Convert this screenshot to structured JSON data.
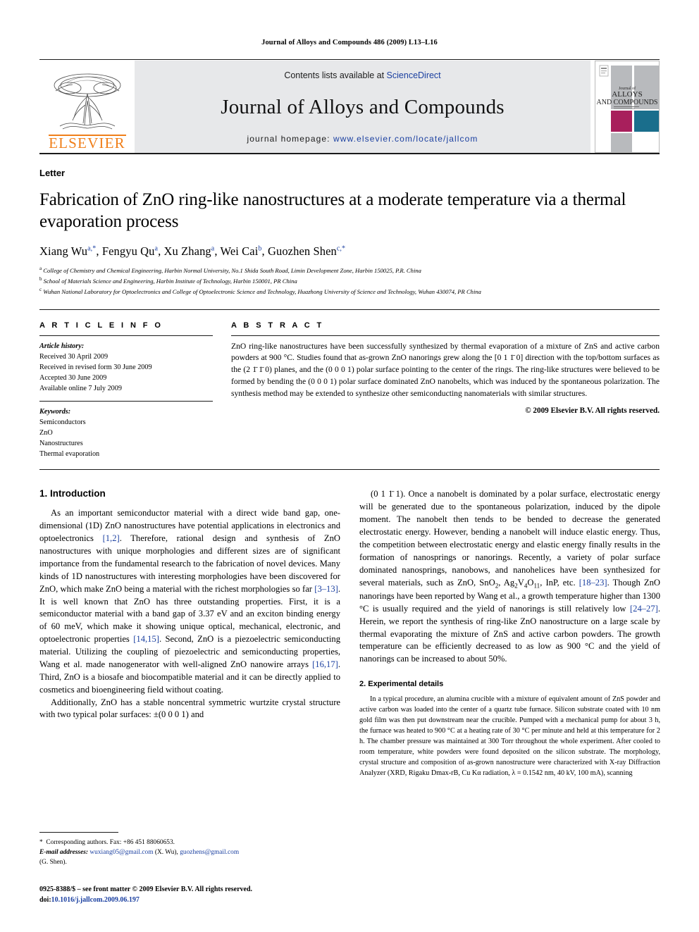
{
  "running_head": "Journal of Alloys and Compounds 486 (2009) L13–L16",
  "masthead": {
    "contents_prefix": "Contents lists available at ",
    "sciencedirect": "ScienceDirect",
    "journal_title": "Journal of Alloys and Compounds",
    "homepage_prefix": "journal homepage: ",
    "homepage_url": "www.elsevier.com/locate/jallcom",
    "publisher_wordmark": "ELSEVIER",
    "cover": {
      "line1": "Journal of",
      "line2": "ALLOYS",
      "line3": "AND COMPOUNDS",
      "accent_magenta": "#a81f5c",
      "accent_teal": "#1a6e8c",
      "panel_gray": "#b8babd"
    },
    "link_color": "#1a3fa0",
    "elsevier_orange": "#f07f1a",
    "band_gray": "#e7e8ea"
  },
  "article": {
    "doctype": "Letter",
    "title": "Fabrication of ZnO ring-like nanostructures at a moderate temperature via a thermal evaporation process",
    "authors": [
      {
        "name": "Xiang Wu",
        "marks": "a,*"
      },
      {
        "name": "Fengyu Qu",
        "marks": "a"
      },
      {
        "name": "Xu Zhang",
        "marks": "a"
      },
      {
        "name": "Wei Cai",
        "marks": "b"
      },
      {
        "name": "Guozhen Shen",
        "marks": "c,*"
      }
    ],
    "affiliations": [
      {
        "mark": "a",
        "text": "College of Chemistry and Chemical Engineering, Harbin Normal University, No.1 Shida South Road, Limin Development Zone, Harbin 150025, P.R. China"
      },
      {
        "mark": "b",
        "text": "School of Materials Science and Engineering, Harbin Institute of Technology, Harbin 150001, PR China"
      },
      {
        "mark": "c",
        "text": "Wuhan National Laboratory for Optoelectronics and College of Optoelectronic Science and Technology, Huazhong University of Science and Technology, Wuhan 430074, PR China"
      }
    ]
  },
  "info": {
    "heading": "A R T I C L E    I N F O",
    "history_label": "Article history:",
    "history": [
      "Received 30 April 2009",
      "Received in revised form 30 June 2009",
      "Accepted 30 June 2009",
      "Available online 7 July 2009"
    ],
    "keywords_label": "Keywords:",
    "keywords": [
      "Semiconductors",
      "ZnO",
      "Nanostructures",
      "Thermal evaporation"
    ]
  },
  "abstract": {
    "heading": "A B S T R A C T",
    "p1": "ZnO ring-like nanostructures have been successfully synthesized by thermal evaporation of a mixture of ZnS and active carbon powders at 900 °C. Studies found that as-grown ZnO nanorings grew along the [0 1 1̄ 0] direction with the top/bottom surfaces as the (2 1̄ 1̄ 0) planes, and the (0 0 0 1) polar surface pointing to the center of the rings. The ring-like structures were believed to be formed by bending the (0 0 0 1) polar surface dominated ZnO nanobelts, which was induced by the spontaneous polarization. The synthesis method may be extended to synthesize other semiconducting nanomaterials with similar structures.",
    "copyright": "© 2009 Elsevier B.V. All rights reserved."
  },
  "sections": {
    "intro_heading": "1.  Introduction",
    "experimental_heading": "2.  Experimental details"
  },
  "body": {
    "intro_p1_a": "As an important semiconductor material with a direct wide band gap, one-dimensional (1D) ZnO nanostructures have potential applications in electronics and optoelectronics ",
    "cite_1_2": "[1,2]",
    "intro_p1_b": ". Therefore, rational design and synthesis of ZnO nanostructures with unique morphologies and different sizes are of significant importance from the fundamental research to the fabrication of novel devices. Many kinds of 1D nanostructures with interesting morphologies have been discovered for ZnO, which make ZnO being a material with the richest morphologies so far ",
    "cite_3_13": "[3–13]",
    "intro_p1_c": ". It is well known that ZnO has three outstanding properties. First, it is a semiconductor material with a band gap of 3.37 eV and an exciton binding energy of 60 meV, which make it showing unique optical, mechanical, electronic, and optoelectronic properties ",
    "cite_14_15": "[14,15]",
    "intro_p1_d": ". Second, ZnO is a piezoelectric semiconducting material. Utilizing the coupling of piezoelectric and semiconducting properties, Wang et al. made nanogenerator with well-aligned ZnO nanowire arrays ",
    "cite_16_17": "[16,17]",
    "intro_p1_e": ". Third, ZnO is a biosafe and biocompatible material and it can be directly applied to cosmetics and bioengineering field without coating.",
    "intro_p2": "Additionally, ZnO has a stable noncentral symmetric wurtzite crystal structure with two typical polar surfaces: ±(0 0 0 1) and",
    "right_p1_a": "(0 1 1̄ 1). Once a nanobelt is dominated by a polar surface, electrostatic energy will be generated due to the spontaneous polarization, induced by the dipole moment. The nanobelt then tends to be bended to decrease the generated electrostatic energy. However, bending a nanobelt will induce elastic energy. Thus, the competition between electrostatic energy and elastic energy finally results in the formation of nanosprings or nanorings. Recently, a variety of polar surface dominated nanosprings, nanobows, and nanohelices have been synthesized for several materials, such as ZnO, SnO",
    "right_p1_sub1": "2",
    "right_p1_b": ", Ag",
    "right_p1_sub2": "2",
    "right_p1_c": "V",
    "right_p1_sub3": "4",
    "right_p1_d": "O",
    "right_p1_sub4": "11",
    "right_p1_e": ", InP, etc. ",
    "cite_18_23": "[18–23]",
    "right_p1_f": ". Though ZnO nanorings have been reported by Wang et al., a growth temperature higher than 1300 °C is usually required and the yield of nanorings is still relatively low ",
    "cite_24_27": "[24–27]",
    "right_p1_g": ". Herein, we report the synthesis of ring-like ZnO nanostructure on a large scale by thermal evaporating the mixture of ZnS and active carbon powders. The growth temperature can be efficiently decreased to as low as 900 °C and the yield of nanorings can be increased to about 50%.",
    "exp_p1_a": "In a typical procedure, an alumina crucible with a mixture of equivalent amount of ZnS powder and active carbon was loaded into the center of a quartz tube furnace. Silicon substrate coated with 10 nm gold film was then put downstream near the crucible. Pumped with a mechanical pump for about 3 h, the furnace was heated to 900 °C at a heating rate of 30 °C per minute and held at this temperature for 2 h. The chamber pressure was maintained at 300 Torr throughout the whole experiment. After cooled to room temperature, white powders were found deposited on the silicon substrate. The morphology, crystal structure and composition of as-grown nanostructure were characterized with X-ray Diffraction Analyzer (XRD, Rigaku Dmax-rB, Cu Kα radiation, λ = 0.1542 nm, 40 kV, 100 mA), scanning"
  },
  "footnote": {
    "star": "*",
    "corresponding": "Corresponding authors. Fax: +86 451 88060653.",
    "email_label": "E-mail addresses:",
    "email1": "wuxiang05@gmail.com",
    "email1_who": "(X. Wu)",
    "email2": "guozhens@gmail.com",
    "email2_who": "(G. Shen)."
  },
  "page_footer": {
    "front_matter": "0925-8388/$ – see front matter © 2009 Elsevier B.V. All rights reserved.",
    "doi_label": "doi:",
    "doi": "10.1016/j.jallcom.2009.06.197"
  }
}
